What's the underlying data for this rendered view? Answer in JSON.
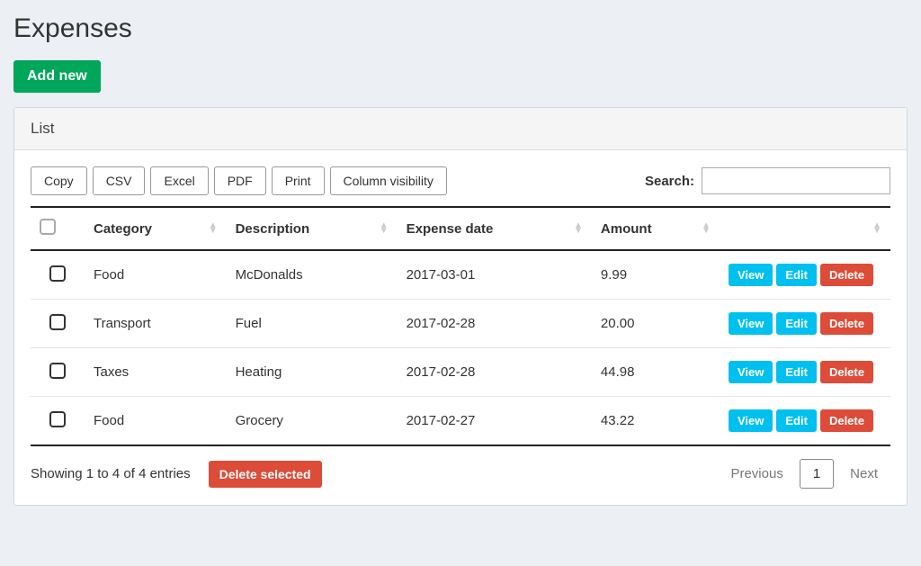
{
  "page": {
    "title": "Expenses",
    "add_button": "Add new"
  },
  "panel": {
    "title": "List"
  },
  "export_buttons": {
    "copy": "Copy",
    "csv": "CSV",
    "excel": "Excel",
    "pdf": "PDF",
    "print": "Print",
    "colvis": "Column visibility"
  },
  "search": {
    "label": "Search:",
    "value": ""
  },
  "columns": {
    "category": "Category",
    "description": "Description",
    "date": "Expense date",
    "amount": "Amount"
  },
  "rows": [
    {
      "category": "Food",
      "description": "McDonalds",
      "date": "2017-03-01",
      "amount": "9.99"
    },
    {
      "category": "Transport",
      "description": "Fuel",
      "date": "2017-02-28",
      "amount": "20.00"
    },
    {
      "category": "Taxes",
      "description": "Heating",
      "date": "2017-02-28",
      "amount": "44.98"
    },
    {
      "category": "Food",
      "description": "Grocery",
      "date": "2017-02-27",
      "amount": "43.22"
    }
  ],
  "row_actions": {
    "view": "View",
    "edit": "Edit",
    "delete": "Delete"
  },
  "footer": {
    "info": "Showing 1 to 4 of 4 entries",
    "delete_selected": "Delete selected",
    "previous": "Previous",
    "next": "Next",
    "current_page": "1"
  }
}
